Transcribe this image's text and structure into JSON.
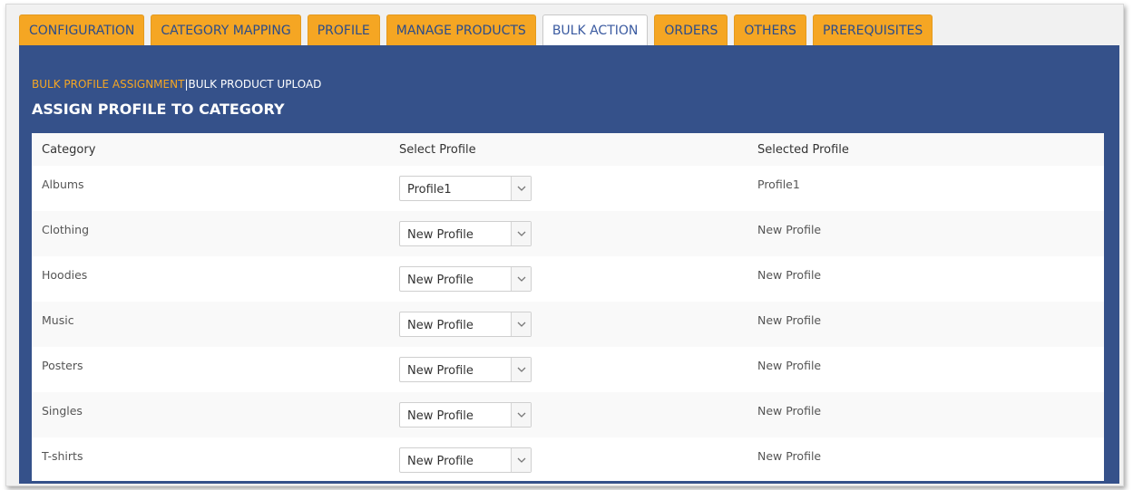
{
  "tabs": [
    {
      "label": "CONFIGURATION",
      "active": false
    },
    {
      "label": "CATEGORY MAPPING",
      "active": false
    },
    {
      "label": "PROFILE",
      "active": false
    },
    {
      "label": "MANAGE PRODUCTS",
      "active": false
    },
    {
      "label": "BULK ACTION",
      "active": true
    },
    {
      "label": "ORDERS",
      "active": false
    },
    {
      "label": "OTHERS",
      "active": false
    },
    {
      "label": "PREREQUISITES",
      "active": false
    }
  ],
  "subnav": {
    "active_label": "BULK PROFILE ASSIGNMENT",
    "separator": "|",
    "other_label": "BULK PRODUCT UPLOAD"
  },
  "page_title": "ASSIGN PROFILE TO CATEGORY",
  "table": {
    "headers": {
      "category": "Category",
      "select_profile": "Select Profile",
      "selected_profile": "Selected Profile"
    },
    "rows": [
      {
        "category": "Albums",
        "select_value": "Profile1",
        "selected": "Profile1"
      },
      {
        "category": "Clothing",
        "select_value": "New Profile",
        "selected": "New Profile"
      },
      {
        "category": "Hoodies",
        "select_value": "New Profile",
        "selected": "New Profile"
      },
      {
        "category": "Music",
        "select_value": "New Profile",
        "selected": "New Profile"
      },
      {
        "category": "Posters",
        "select_value": "New Profile",
        "selected": "New Profile"
      },
      {
        "category": "Singles",
        "select_value": "New Profile",
        "selected": "New Profile"
      },
      {
        "category": "T-shirts",
        "select_value": "New Profile",
        "selected": "New Profile"
      }
    ]
  },
  "colors": {
    "tab_bg": "#f5a623",
    "tab_text": "#2b4c8a",
    "panel_bg": "#35518a",
    "accent": "#f5a623"
  },
  "icons": {
    "dropdown": "chevron-down-icon"
  }
}
